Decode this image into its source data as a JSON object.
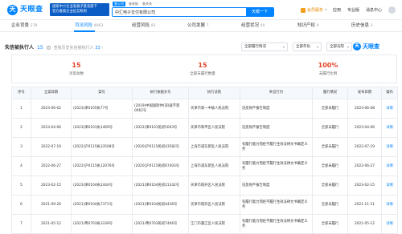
{
  "header": {
    "logo_mark": "天",
    "logo_text": "天眼查",
    "promo_line1": "国家中小企业发展子基金旗下",
    "promo_line2": "官方备案企业征信机构",
    "search_tabs": [
      "查公司",
      "查老板",
      "查关系"
    ],
    "search_value": "中汇电子支付有限公司",
    "search_button": "天眼一下",
    "vip_label": "会员服务",
    "links": [
      "应用",
      "专业版",
      "消息中心"
    ]
  },
  "nav": {
    "tabs": [
      {
        "label": "企业背景",
        "count": "278"
      },
      {
        "label": "司法风险",
        "count": "4063"
      },
      {
        "label": "经营风险",
        "count": "83"
      },
      {
        "label": "公司发展",
        "count": "7"
      },
      {
        "label": "经营状况",
        "count": "40"
      },
      {
        "label": "知识产权",
        "count": "9"
      },
      {
        "label": "历史信息",
        "count": "3"
      }
    ]
  },
  "section": {
    "title": "失信被执行人",
    "count": "15",
    "help": "?",
    "link_prefix": "查看历史失信被执行人",
    "link_count": "33",
    "filters": [
      "全部履行情况",
      "全部年份",
      "全部法院"
    ],
    "watermark": "天眼查"
  },
  "stats": [
    {
      "value": "15",
      "label": "涉案总数"
    },
    {
      "value": "15",
      "label": "全部未履行数量"
    },
    {
      "value": "100%",
      "label": "未履行比例"
    }
  ],
  "table": {
    "columns": [
      "序号",
      "立案日期",
      "案号",
      "执行依据文号",
      "执行法院",
      "失信行为",
      "履行情况",
      "发布日期",
      "操作"
    ],
    "rows": [
      [
        "1",
        "2023-06-02",
        "(2023)津0105执77号",
        "(2019)中国国际仲(深)裁字第0062号",
        "天津市第一中级人民法院",
        "违反财产报告制度",
        "全部未履行",
        "2023-06-08",
        "详情"
      ],
      [
        "2",
        "2023-04-06",
        "(2023)津0101执1469号",
        "(2022)津0101民初5003号",
        "天津市和平区人民法院",
        "违反财产报告制度",
        "全部未履行",
        "2023-04-06",
        "详情"
      ],
      [
        "3",
        "2022-07-19",
        "(2022)沪0115执33508号",
        "(2020)沪0115民初43582号",
        "上海市浦东新区人民法院",
        "有履行能力而拒不履行生效法律文书确定义务",
        "全部未履行",
        "2022-07-19",
        "详情"
      ],
      [
        "4",
        "2022-06-27",
        "(2022)沪0115执12076号",
        "(2020)沪0115民初67403号",
        "上海市浦东新区人民法院",
        "有履行能力而拒不履行生效法律文书确定义务",
        "全部未履行",
        "2022-06-27",
        "详情"
      ],
      [
        "5",
        "2023-02-15",
        "(2023)津0104执2444号",
        "(2021)津0104民初21342号",
        "天津市南开区人民法院",
        "违反财产报告制度",
        "全部未履行",
        "2023-02-15",
        "详情"
      ],
      [
        "6",
        "2021-09-26",
        "(2021)津0104执7371号",
        "(2021)津0104民初4436号",
        "天津市南开区人民法院",
        "有履行能力而拒不履行生效法律文书确定义务",
        "全部未履行",
        "2021-11-11",
        "详情"
      ],
      [
        "7",
        "2021-05-12",
        "(2021)粤0703执3339号",
        "(2021)粤0703民初7466号",
        "江门市蓬江区人民法院",
        "有履行能力而拒不履行生效法律文书确定义务",
        "全部未履行",
        "2021-05-12",
        "详情"
      ]
    ]
  }
}
